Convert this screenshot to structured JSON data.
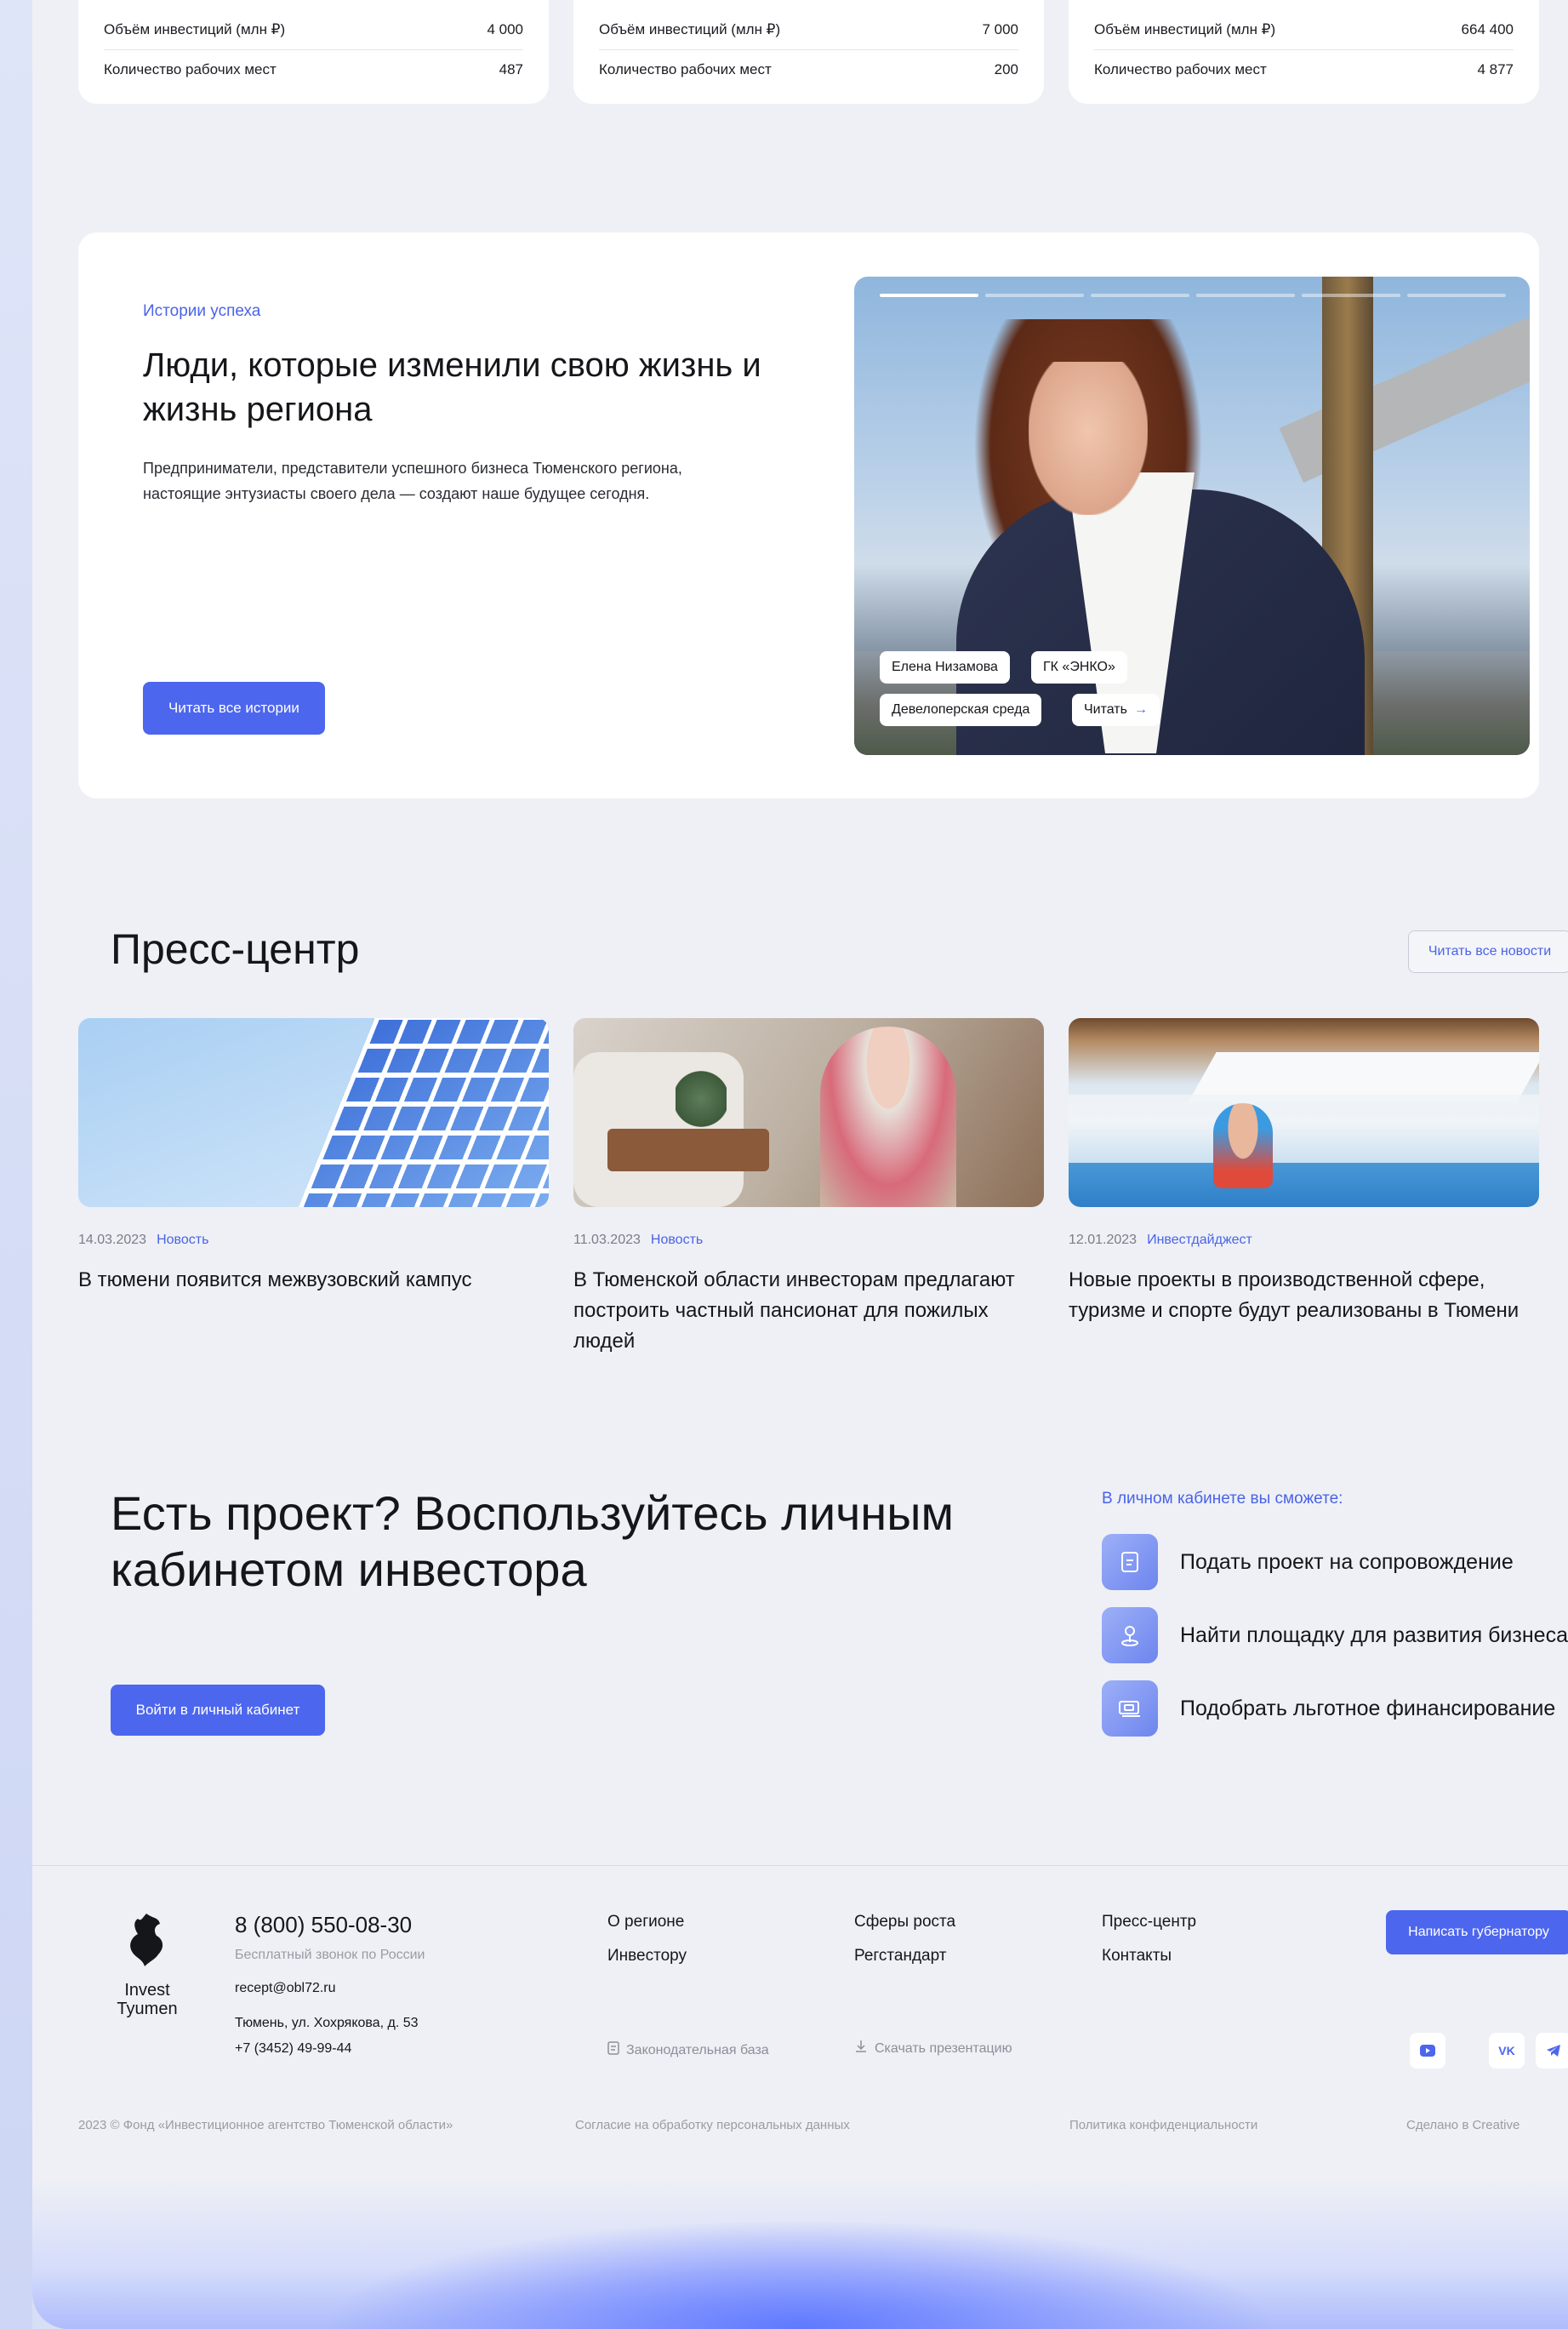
{
  "stats": [
    {
      "rows": [
        {
          "label": "Объём инвестиций (млн ₽)",
          "value": "4 000"
        },
        {
          "label": "Количество рабочих мест",
          "value": "487"
        }
      ]
    },
    {
      "rows": [
        {
          "label": "Объём инвестиций (млн ₽)",
          "value": "7 000"
        },
        {
          "label": "Количество рабочих мест",
          "value": "200"
        }
      ]
    },
    {
      "rows": [
        {
          "label": "Объём инвестиций (млн ₽)",
          "value": "664 400"
        },
        {
          "label": "Количество рабочих мест",
          "value": "4 877"
        }
      ]
    }
  ],
  "stories": {
    "eyebrow": "Истории успеха",
    "title": "Люди, которые изменили свою жизнь и жизнь региона",
    "description": "Предприниматели, представители успешного бизнеса Тюменского региона, настоящие энтузиасты своего дела — создают наше будущее сегодня.",
    "button": "Читать все истории",
    "slide": {
      "person": "Елена Низамова",
      "company": "ГК «ЭНКО»",
      "sector": "Девелоперская среда",
      "read": "Читать",
      "arrow": "→",
      "progress_count": 6,
      "active_index": 0
    }
  },
  "press": {
    "title": "Пресс-центр",
    "all_news": "Читать все новости",
    "items": [
      {
        "date": "14.03.2023",
        "category": "Новость",
        "title": "В тюмени появится межвузовский кампус"
      },
      {
        "date": "11.03.2023",
        "category": "Новость",
        "title": "В Тюменской области инвесторам предлагают построить частный пансионат для пожилых людей"
      },
      {
        "date": "12.01.2023",
        "category": "Инвестдайджест",
        "title": "Новые проекты в производственной сфере, туризме и спорте будут реализованы в Тюмени"
      }
    ]
  },
  "cta": {
    "title": "Есть проект? Воспользуйтесь личным кабинетом инвестора",
    "button": "Войти в личный кабинет",
    "cabinet_eyebrow": "В личном кабинете вы сможете:",
    "features": [
      {
        "icon": "document-icon",
        "label": "Подать проект на сопровождение"
      },
      {
        "icon": "location-pin-icon",
        "label": "Найти площадку для развития бизнеса"
      },
      {
        "icon": "money-icon",
        "label": "Подобрать льготное финансирование"
      }
    ]
  },
  "footer": {
    "logo_line1": "Invest",
    "logo_line2": "Tyumen",
    "phone": "8 (800) 550-08-30",
    "phone_note": "Бесплатный звонок по России",
    "email": "recept@obl72.ru",
    "address": "Тюмень, ул. Хохрякова, д. 53",
    "phone2": "+7 (3452) 49-99-44",
    "nav": {
      "col1": [
        "О регионе",
        "Инвестору"
      ],
      "col2": [
        "Сферы роста",
        "Регстандарт"
      ],
      "col3": [
        "Пресс-центр",
        "Контакты"
      ]
    },
    "legal_base": "Законодательная база",
    "download": "Скачать презентацию",
    "governor_button": "Написать губернатору",
    "social": [
      "youtube-icon",
      "vk-icon",
      "telegram-icon"
    ],
    "social_labels": {
      "vk": "VK"
    },
    "copyright": "2023 © Фонд «Инвестиционное агентство Тюменской области»",
    "consent": "Согласие на обработку персональных данных",
    "privacy": "Политика конфиденциальности",
    "made_by": "Сделано в Creative"
  },
  "colors": {
    "accent": "#4d66ee",
    "background": "#eef0f5"
  }
}
